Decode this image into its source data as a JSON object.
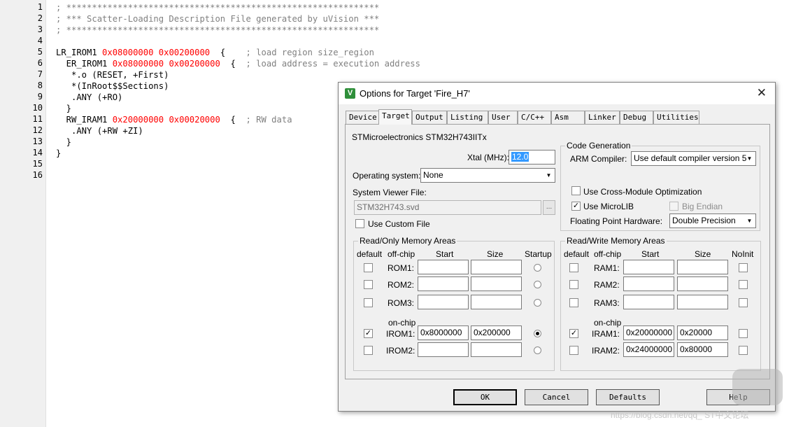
{
  "editor": {
    "line_numbers": [
      "1",
      "2",
      "3",
      "4",
      "5",
      "6",
      "7",
      "8",
      "9",
      "10",
      "11",
      "12",
      "13",
      "14",
      "15",
      "16"
    ],
    "lines": [
      "; *************************************************************",
      "; *** Scatter-Loading Description File generated by uVision ***",
      "; *************************************************************",
      "",
      "LR_IROM1 0x08000000 0x00200000  {    ; load region size_region",
      "  ER_IROM1 0x08000000 0x00200000  {  ; load address = execution address",
      "   *.o (RESET, +First)",
      "   *(InRoot$$Sections)",
      "   .ANY (+RO)",
      "  }",
      "  RW_IRAM1 0x20000000 0x00020000  {  ; RW data",
      "   .ANY (+RW +ZI)",
      "  }",
      "}",
      "",
      ""
    ]
  },
  "dialog": {
    "title": "Options for Target 'Fire_H7'",
    "tabs": [
      "Device",
      "Target",
      "Output",
      "Listing",
      "User",
      "C/C++",
      "Asm",
      "Linker",
      "Debug",
      "Utilities"
    ],
    "active_tab": "Target",
    "device_name": "STMicroelectronics STM32H743IITx",
    "xtal_label": "Xtal (MHz):",
    "xtal_value": "12.0",
    "os_label": "Operating system:",
    "os_value": "None",
    "svf_label": "System Viewer File:",
    "svf_value": "STM32H743.svd",
    "browse_label": "...",
    "use_custom_file_label": "Use Custom File",
    "code_gen": {
      "title": "Code Generation",
      "arm_compiler_label": "ARM Compiler:",
      "arm_compiler_value": "Use default compiler version 5",
      "cross_module_label": "Use Cross-Module Optimization",
      "microlib_label": "Use MicroLIB",
      "big_endian_label": "Big Endian",
      "fpu_label": "Floating Point Hardware:",
      "fpu_value": "Double Precision"
    },
    "ro_mem": {
      "title": "Read/Only Memory Areas",
      "headers": {
        "default": "default",
        "offchip": "off-chip",
        "start": "Start",
        "size": "Size",
        "startup": "Startup"
      },
      "onchip_label": "on-chip",
      "rows": [
        {
          "name": "ROM1:",
          "start": "",
          "size": "",
          "default": false,
          "startup": false
        },
        {
          "name": "ROM2:",
          "start": "",
          "size": "",
          "default": false,
          "startup": false
        },
        {
          "name": "ROM3:",
          "start": "",
          "size": "",
          "default": false,
          "startup": false
        },
        {
          "name": "IROM1:",
          "start": "0x8000000",
          "size": "0x200000",
          "default": true,
          "startup": true
        },
        {
          "name": "IROM2:",
          "start": "",
          "size": "",
          "default": false,
          "startup": false
        }
      ]
    },
    "rw_mem": {
      "title": "Read/Write Memory Areas",
      "headers": {
        "default": "default",
        "offchip": "off-chip",
        "start": "Start",
        "size": "Size",
        "noinit": "NoInit"
      },
      "onchip_label": "on-chip",
      "rows": [
        {
          "name": "RAM1:",
          "start": "",
          "size": "",
          "default": false
        },
        {
          "name": "RAM2:",
          "start": "",
          "size": "",
          "default": false
        },
        {
          "name": "RAM3:",
          "start": "",
          "size": "",
          "default": false
        },
        {
          "name": "IRAM1:",
          "start": "0x20000000",
          "size": "0x20000",
          "default": true
        },
        {
          "name": "IRAM2:",
          "start": "0x24000000",
          "size": "0x80000",
          "default": false
        }
      ]
    },
    "buttons": {
      "ok": "OK",
      "cancel": "Cancel",
      "defaults": "Defaults",
      "help": "Help"
    }
  },
  "watermark": "https://blog.csdn.net/qq_  ST中文论坛"
}
